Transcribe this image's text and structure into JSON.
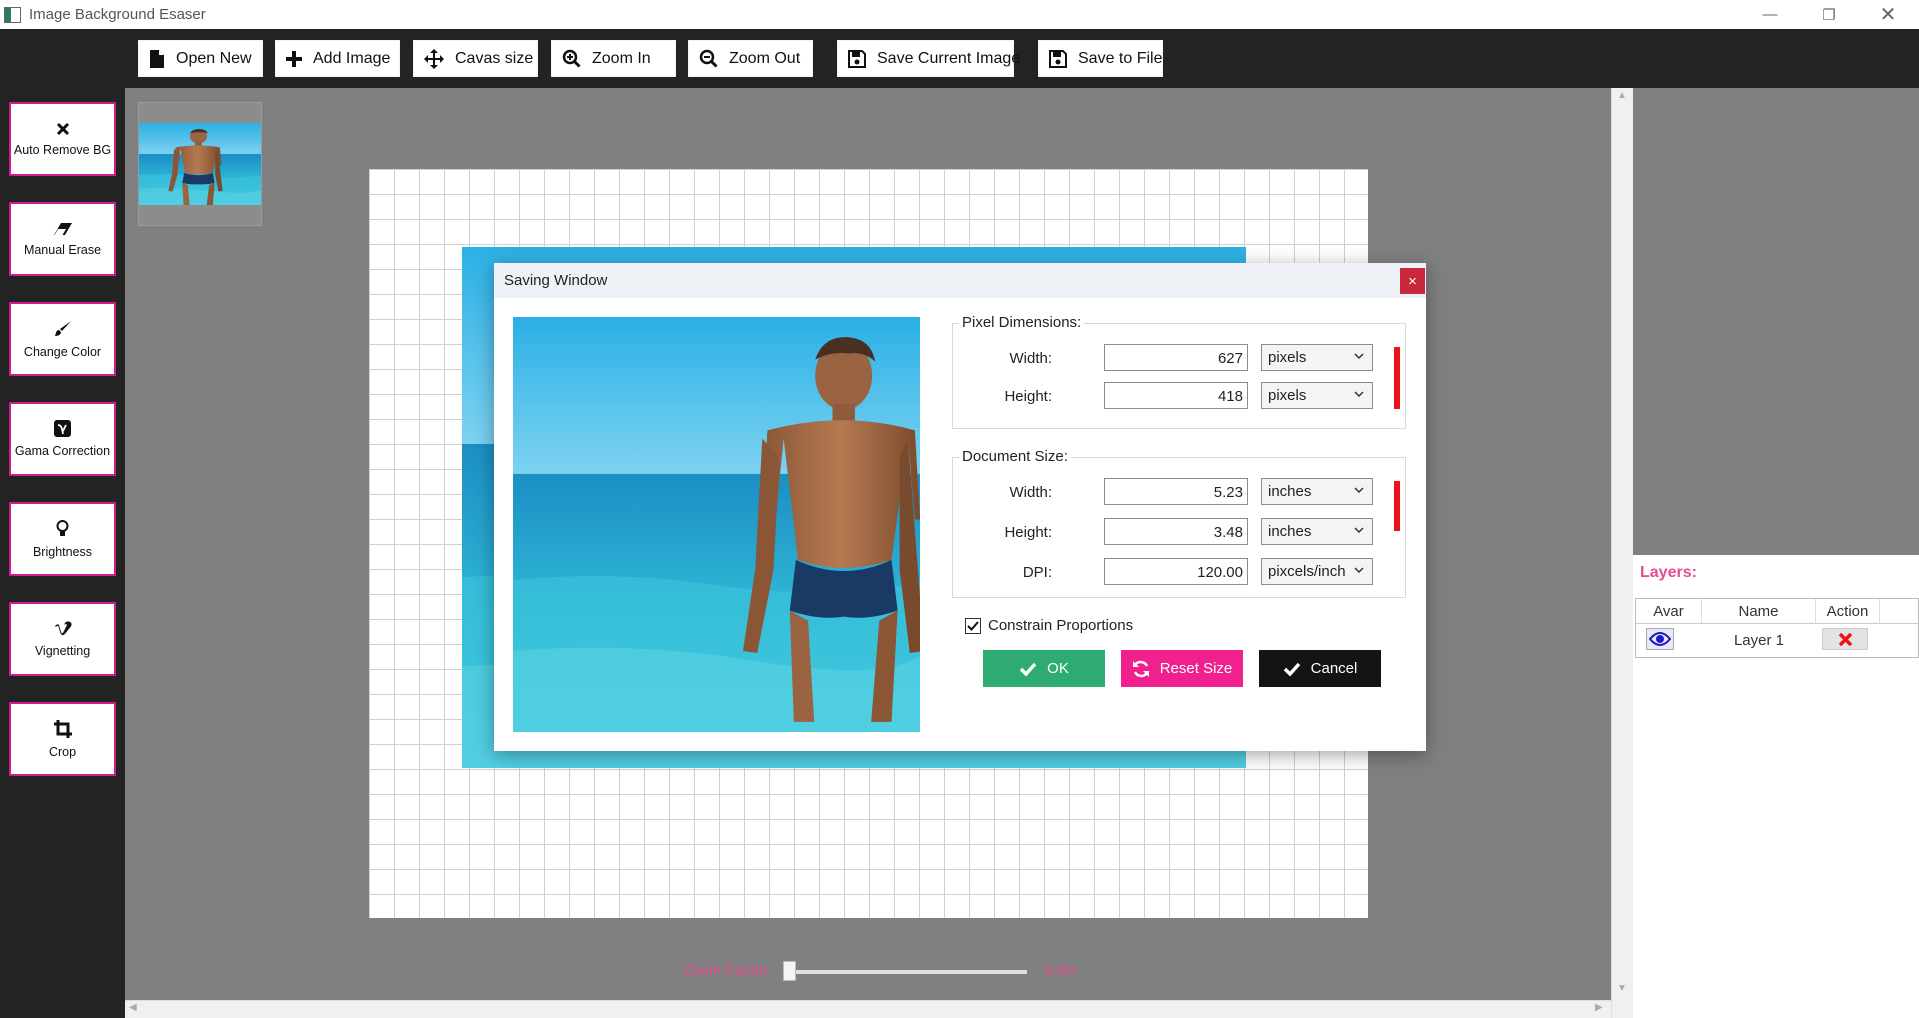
{
  "window": {
    "title": "Image Background Esaser",
    "minimize_icon": "minimize-icon",
    "restore_icon": "restore-icon",
    "close_icon": "close-icon"
  },
  "toolbar": [
    {
      "label": "Open New",
      "icon": "file-icon"
    },
    {
      "label": "Add Image",
      "icon": "plus-icon"
    },
    {
      "label": "Cavas size",
      "icon": "move-arrows-icon"
    },
    {
      "label": "Zoom In",
      "icon": "zoom-in-icon"
    },
    {
      "label": "Zoom Out",
      "icon": "zoom-out-icon"
    },
    {
      "label": "Save Current Image",
      "icon": "floppy-icon"
    },
    {
      "label": "Save to File",
      "icon": "floppy-icon"
    }
  ],
  "tools": [
    {
      "label": "Auto Remove BG",
      "icon": "x-icon"
    },
    {
      "label": "Manual Erase",
      "icon": "eraser-icon"
    },
    {
      "label": "Change Color",
      "icon": "brush-icon"
    },
    {
      "label": "Gama Correction",
      "icon": "gamma-icon"
    },
    {
      "label": "Brightness",
      "icon": "lightbulb-icon"
    },
    {
      "label": "Vignetting",
      "icon": "vimeo-icon"
    },
    {
      "label": "Crop",
      "icon": "crop-icon"
    }
  ],
  "zoom": {
    "label": "Zoom Factor",
    "value_text": "0.00",
    "value": 0
  },
  "layers": {
    "title": "Layers:",
    "columns": [
      "Avar",
      "Name",
      "Action"
    ],
    "rows": [
      {
        "name": "Layer 1",
        "visible_icon": "eye-icon",
        "action_icon": "delete-x-icon"
      }
    ]
  },
  "dialog": {
    "title": "Saving Window",
    "close_label": "×",
    "pixel_dimensions": {
      "label": "Pixel Dimensions:",
      "width_label": "Width:",
      "width_value": "627",
      "width_unit": "pixels",
      "height_label": "Height:",
      "height_value": "418",
      "height_unit": "pixels"
    },
    "document_size": {
      "label": "Document Size:",
      "width_label": "Width:",
      "width_value": "5.23",
      "width_unit": "inches",
      "height_label": "Height:",
      "height_value": "3.48",
      "height_unit": "inches",
      "dpi_label": "DPI:",
      "dpi_value": "120.00",
      "dpi_unit": "pixcels/inch"
    },
    "constrain": {
      "label": "Constrain Proportions",
      "checked": true
    },
    "buttons": {
      "ok": "OK",
      "reset": "Reset Size",
      "cancel": "Cancel"
    },
    "colors": {
      "ok": "#2eab70",
      "reset": "#f0208f",
      "cancel": "#141414",
      "link_bar": "#e8141c"
    }
  }
}
